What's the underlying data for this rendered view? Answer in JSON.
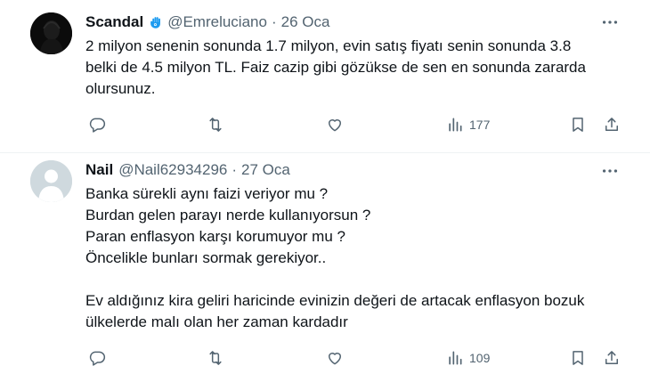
{
  "tweets": [
    {
      "name": "Scandal",
      "badge_icon": "hamsa-icon",
      "handle": "@Emreluciano",
      "dot": "·",
      "date": "26 Oca",
      "lines": [
        "2 milyon senenin sonunda 1.7 milyon, evin satış fiyatı senin sonunda 3.8",
        "belki de 4.5 milyon TL. Faiz cazip gibi gözükse de sen en sonunda zararda",
        "olursunuz."
      ],
      "views": "177"
    },
    {
      "name": "Nail",
      "handle": "@Nail62934296",
      "dot": "·",
      "date": "27 Oca",
      "lines": [
        "Banka sürekli aynı faizi veriyor mu ?",
        "Burdan gelen parayı nerde kullanıyorsun ?",
        "Paran enflasyon karşı korumuyor mu ?",
        "Öncelikle bunları sormak gerekiyor..",
        "",
        "Ev aldığınız kira geliri haricinde evinizin değeri de artacak enflasyon bozuk",
        "ülkelerde malı olan her zaman kardadır"
      ],
      "views": "109"
    }
  ],
  "colors": {
    "text": "#0f1419",
    "secondary": "#536471",
    "divider": "#eff3f4",
    "badge": "#1d9bf0",
    "default_avatar_bg": "#cfd9de"
  }
}
